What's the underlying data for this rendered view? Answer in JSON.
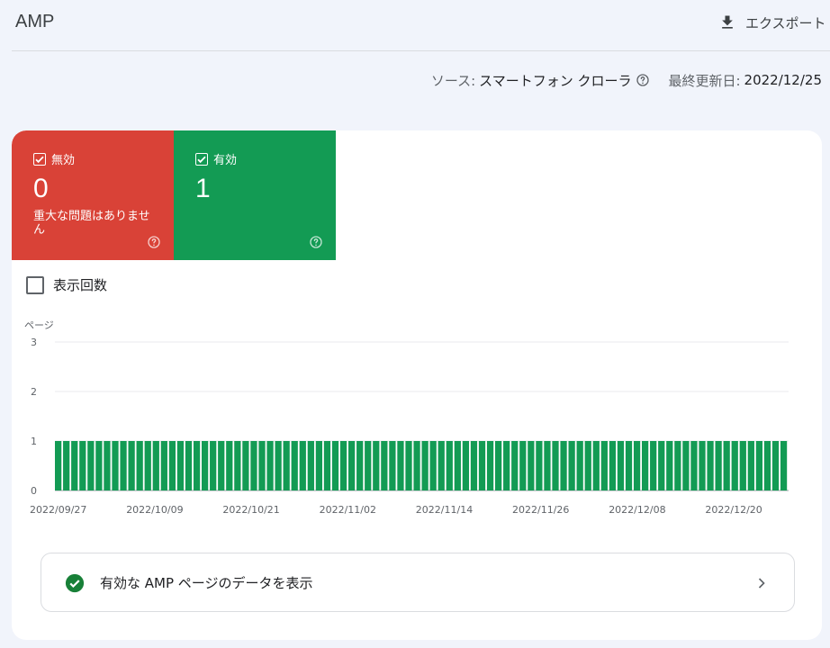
{
  "header": {
    "title": "AMP",
    "export_label": "エクスポート"
  },
  "source": {
    "source_label": "ソース:",
    "source_value": "スマートフォン クローラ",
    "updated_label": "最終更新日:",
    "updated_value": "2022/12/25"
  },
  "tiles": {
    "invalid": {
      "label": "無効",
      "count": "0",
      "subtitle": "重大な問題はありません",
      "color": "#d94237"
    },
    "valid": {
      "label": "有効",
      "count": "1",
      "color": "#139b54"
    }
  },
  "impressions_label": "表示回数",
  "chart_data": {
    "type": "bar",
    "ylabel": "ページ",
    "ylim": [
      0,
      3
    ],
    "yticks": [
      "0",
      "1",
      "2",
      "3"
    ],
    "x_tick_labels": [
      "2022/09/27",
      "2022/10/09",
      "2022/10/21",
      "2022/11/02",
      "2022/11/14",
      "2022/11/26",
      "2022/12/08",
      "2022/12/20"
    ],
    "start_date": "2022/09/27",
    "end_date": "2022/12/25",
    "bar_value": 1,
    "bar_count": 90,
    "color": "#139b54"
  },
  "link_card": {
    "label": "有効な AMP ページのデータを表示"
  }
}
